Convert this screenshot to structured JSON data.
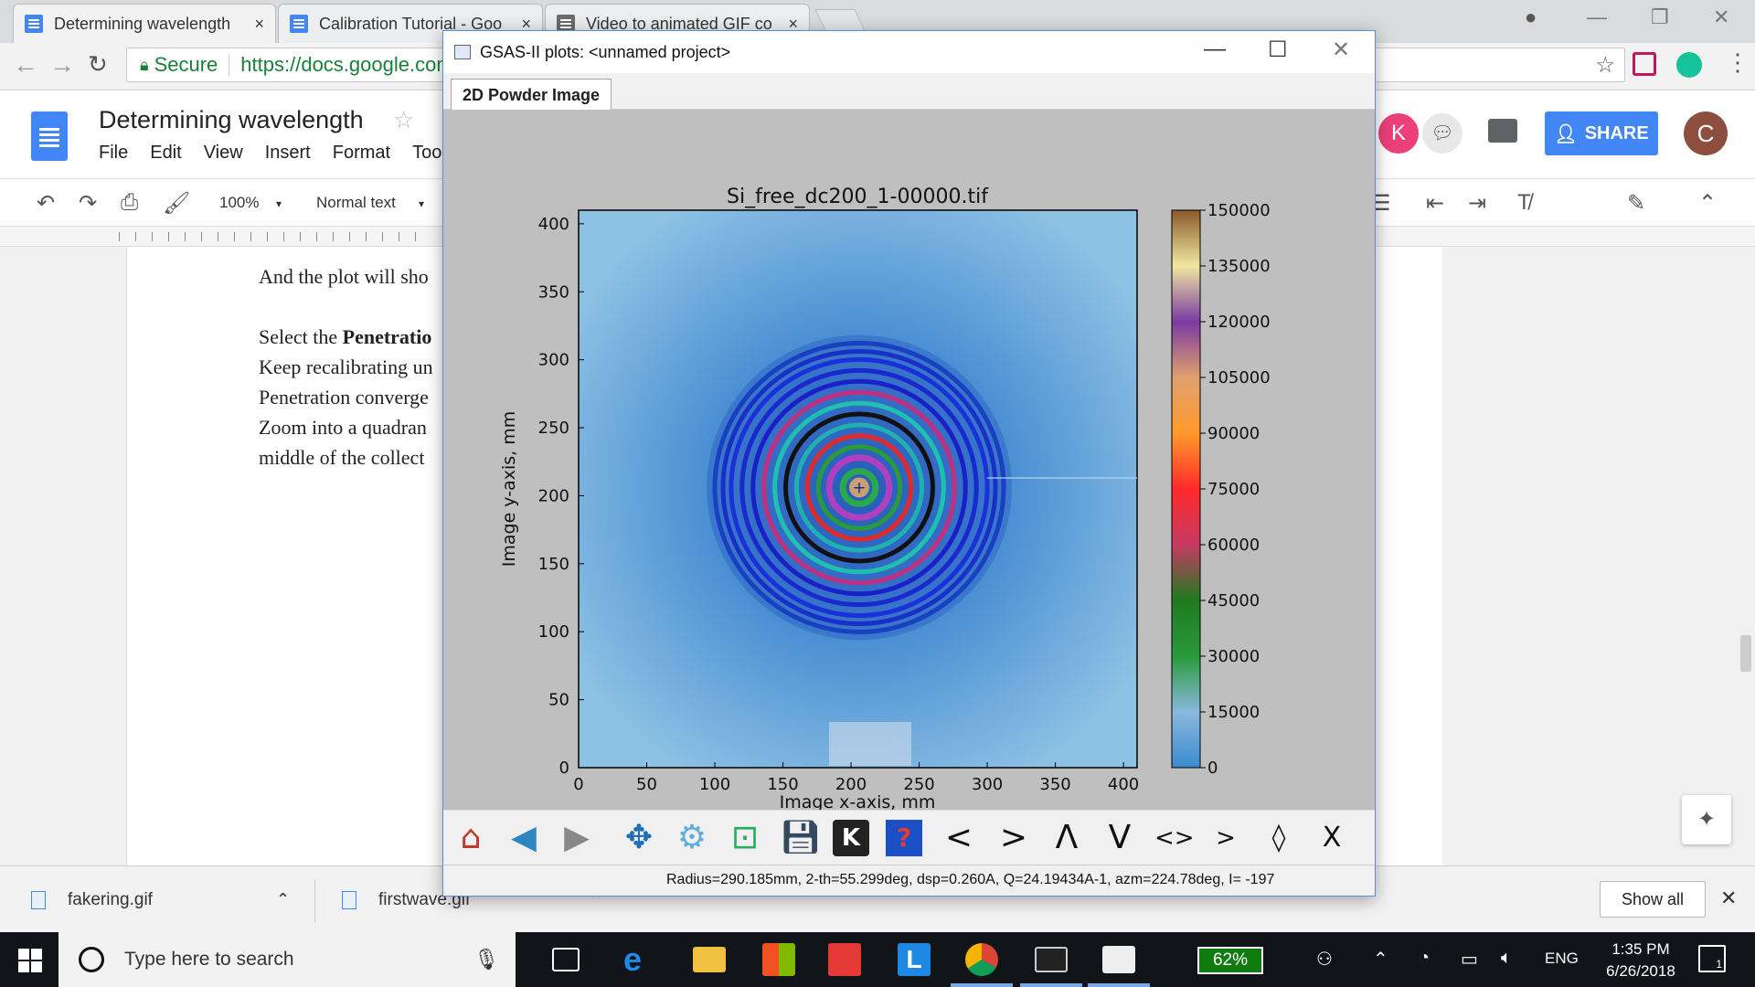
{
  "browser": {
    "tabs": [
      {
        "title": "Determining wavelength",
        "close": "×"
      },
      {
        "title": "Calibration Tutorial - Goo",
        "close": "×"
      },
      {
        "title": "Video to animated GIF co",
        "close": "×"
      }
    ],
    "secure_label": "Secure",
    "url": "https://docs.google.com"
  },
  "docs": {
    "title": "Determining wavelength",
    "menu": [
      "File",
      "Edit",
      "View",
      "Insert",
      "Format",
      "Tool"
    ],
    "share_label": "SHARE",
    "avatar_k": "K",
    "avatar_c": "C",
    "zoom": "100%",
    "style": "Normal text",
    "body_lines": [
      "And the plot will sho",
      "",
      "Select the Penetratio",
      "Keep recalibrating un",
      "Penetration converge",
      "Zoom into a quadran",
      "middle of the collect"
    ],
    "bold_word": "Penetratio",
    "select_prefix": "Select the "
  },
  "downloads": {
    "items": [
      "fakering.gif",
      "firstwave.gif"
    ],
    "show_all": "Show all"
  },
  "taskbar": {
    "search_placeholder": "Type here to search",
    "battery": "62%",
    "lang": "ENG",
    "time": "1:35 PM",
    "date": "6/26/2018",
    "notif_count": "1"
  },
  "gsas": {
    "window_title": "GSAS-II plots: <unnamed project>",
    "tab": "2D Powder Image",
    "status": "Radius=290.185mm, 2-th=55.299deg, dsp=0.260A, Q=24.19434A-1, azm=224.78deg, I=  -197",
    "tools": [
      "home-icon",
      "back-icon",
      "forward-icon",
      "pan-icon",
      "configure-icon",
      "zoom-icon",
      "save-icon",
      "key-icon",
      "help-icon",
      "<",
      ">",
      "Λ",
      "V",
      "<>",
      "><",
      "◊",
      "Ⅹ"
    ]
  },
  "chart_data": {
    "type": "heatmap",
    "title": "Si_free_dc200_1-00000.tif",
    "xlabel": "Image x-axis, mm",
    "ylabel": "Image y-axis, mm",
    "xlim": [
      0,
      410
    ],
    "ylim": [
      0,
      410
    ],
    "xticks": [
      "0",
      "50",
      "100",
      "150",
      "200",
      "250",
      "300",
      "350",
      "400"
    ],
    "yticks": [
      "0",
      "50",
      "100",
      "150",
      "200",
      "250",
      "300",
      "350",
      "400"
    ],
    "colorbar": {
      "range": [
        0,
        150000
      ],
      "ticks": [
        "150000",
        "135000",
        "120000",
        "105000",
        "90000",
        "75000",
        "60000",
        "45000",
        "30000",
        "15000",
        "0"
      ]
    },
    "beam_center": [
      206,
      206
    ],
    "rings_mm": [
      5,
      12,
      22,
      30,
      38,
      46,
      54,
      62,
      70,
      78,
      86,
      94,
      100,
      106
    ]
  }
}
